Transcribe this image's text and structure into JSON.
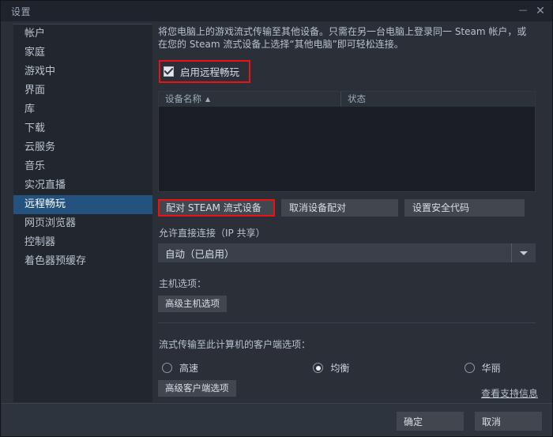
{
  "window": {
    "title": "设置",
    "minimize_label": "—",
    "close_label": "✕"
  },
  "sidebar": {
    "items": [
      {
        "label": "帐户",
        "selected": false
      },
      {
        "label": "家庭",
        "selected": false
      },
      {
        "label": "游戏中",
        "selected": false
      },
      {
        "label": "界面",
        "selected": false
      },
      {
        "label": "库",
        "selected": false
      },
      {
        "label": "下载",
        "selected": false
      },
      {
        "label": "云服务",
        "selected": false
      },
      {
        "label": "音乐",
        "selected": false
      },
      {
        "label": "实况直播",
        "selected": false
      },
      {
        "label": "远程畅玩",
        "selected": true
      },
      {
        "label": "网页浏览器",
        "selected": false
      },
      {
        "label": "控制器",
        "selected": false
      },
      {
        "label": "着色器预缓存",
        "selected": false
      }
    ]
  },
  "content": {
    "description": "将您电脑上的游戏流式传输至其他设备。只需在另一台电脑上登录同一 Steam 帐户，或在您的 Steam 流式设备上选择“其他电脑”即可轻松连接。",
    "enable_checkbox": {
      "label": "启用远程畅玩",
      "checked": true,
      "highlighted": true
    },
    "device_table": {
      "columns": [
        {
          "label": "设备名称",
          "sort": "▲"
        },
        {
          "label": "状态",
          "sort": ""
        }
      ],
      "rows": []
    },
    "pairing_buttons": [
      {
        "label": "配对 STEAM 流式设备",
        "highlighted": true
      },
      {
        "label": "取消设备配对",
        "highlighted": false
      },
      {
        "label": "设置安全代码",
        "highlighted": false
      }
    ],
    "direct_connection": {
      "label": "允许直接连接（IP 共享）",
      "value": "自动（已启用）"
    },
    "host_options": {
      "label": "主机选项：",
      "advanced_button": "高级主机选项"
    },
    "client_options": {
      "label": "流式传输至此计算机的客户端选项：",
      "radios": [
        {
          "label": "高速",
          "selected": false
        },
        {
          "label": "均衡",
          "selected": true
        },
        {
          "label": "华丽",
          "selected": false
        }
      ],
      "advanced_button": "高级客户端选项"
    },
    "support_link": "查看支持信息"
  },
  "footer": {
    "ok_label": "确定",
    "cancel_label": "取消"
  },
  "colors": {
    "accent_selected": "#24527e",
    "highlight_box": "#ee1111",
    "window_bg": "#2a2f38",
    "sidebar_bg": "#22272e"
  }
}
